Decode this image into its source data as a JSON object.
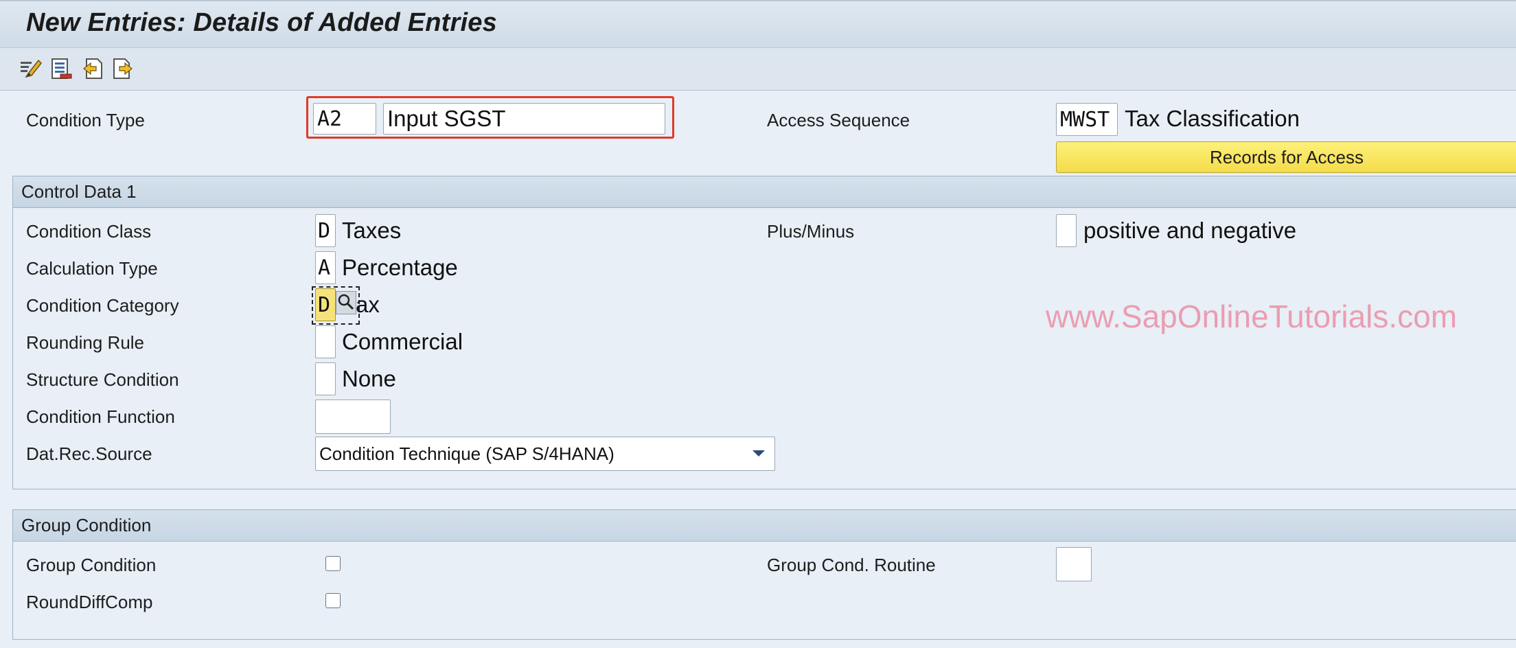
{
  "window": {
    "title": "New Entries: Details of Added Entries"
  },
  "toolbar": {
    "icons": [
      "edit-pencil-icon",
      "save-list-icon",
      "previous-entry-icon",
      "next-entry-icon"
    ]
  },
  "header": {
    "condition_type_label": "Condition Type",
    "condition_type_code": "A2",
    "condition_type_desc": "Input SGST",
    "access_sequence_label": "Access Sequence",
    "access_sequence_code": "MWST",
    "access_sequence_desc": "Tax Classification",
    "records_button": "Records for Access",
    "highlight_color": "#e03a28"
  },
  "control_data": {
    "section_title": "Control Data 1",
    "condition_class": {
      "label": "Condition Class",
      "code": "D",
      "desc": "Taxes"
    },
    "calculation_type": {
      "label": "Calculation Type",
      "code": "A",
      "desc": "Percentage"
    },
    "condition_category": {
      "label": "Condition Category",
      "code": "D",
      "desc": "ax"
    },
    "rounding_rule": {
      "label": "Rounding Rule",
      "code": "",
      "desc": "Commercial"
    },
    "structure_condition": {
      "label": "Structure Condition",
      "code": "",
      "desc": "None"
    },
    "condition_function": {
      "label": "Condition Function",
      "value": ""
    },
    "dat_rec_source": {
      "label": "Dat.Rec.Source",
      "value": "Condition Technique (SAP S/4HANA)"
    },
    "plus_minus": {
      "label": "Plus/Minus",
      "code": "",
      "desc": "positive and negative"
    }
  },
  "group_condition": {
    "section_title": "Group Condition",
    "group_condition_label": "Group Condition",
    "group_condition_checked": false,
    "round_diff_label": "RoundDiffComp",
    "round_diff_checked": false,
    "group_cond_routine_label": "Group Cond. Routine",
    "group_cond_routine_value": ""
  },
  "watermark": "www.SapOnlineTutorials.com"
}
